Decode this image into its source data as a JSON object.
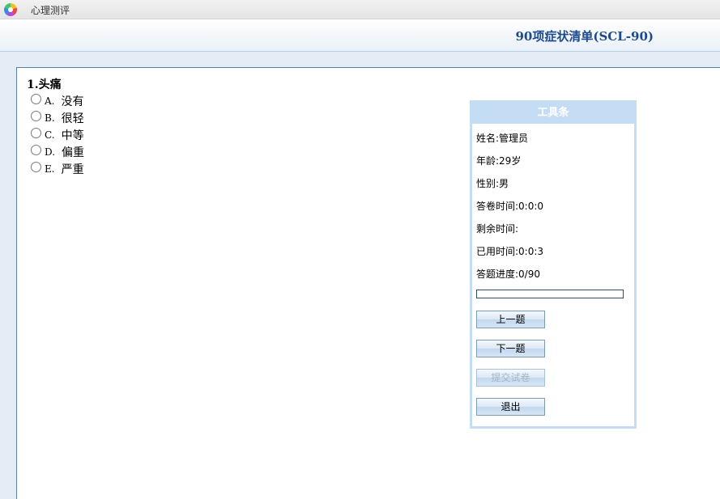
{
  "window": {
    "app_title": "心理测评"
  },
  "header": {
    "page_title": "90项症状清单(SCL-90)"
  },
  "question": {
    "text": "1.头痛",
    "options": [
      {
        "key": "A.",
        "label": "没有"
      },
      {
        "key": "B.",
        "label": "很轻"
      },
      {
        "key": "C.",
        "label": "中等"
      },
      {
        "key": "D.",
        "label": "偏重"
      },
      {
        "key": "E.",
        "label": "严重"
      }
    ]
  },
  "toolbar": {
    "title": "工具条",
    "name": "姓名:管理员",
    "age": "年龄:29岁",
    "gender": "性别:男",
    "exam_time": "答卷时间:0:0:0",
    "remaining_time": "剩余时间:",
    "elapsed_time": "已用时间:0:0:3",
    "progress_text": "答题进度:0/90",
    "progress_fraction": 0,
    "prev_button": "上一题",
    "next_button": "下一题",
    "submit_button": "提交试卷",
    "exit_button": "退出"
  },
  "colors": {
    "title_blue": "#1c4a8c",
    "toolbar_header": "#c5dcf5",
    "page_background": "#e4edf5"
  }
}
